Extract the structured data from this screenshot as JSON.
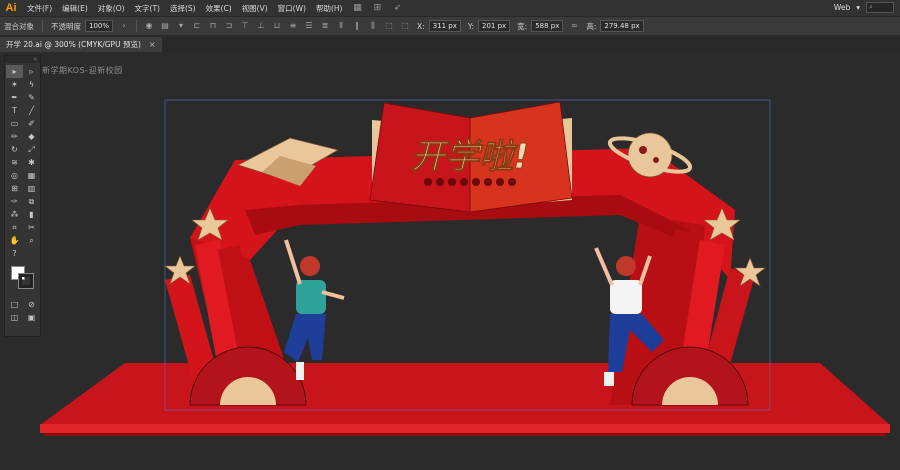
{
  "app": {
    "logo": "Ai"
  },
  "menu": {
    "items": [
      "文件(F)",
      "编辑(E)",
      "对象(O)",
      "文字(T)",
      "选择(S)",
      "效果(C)",
      "视图(V)",
      "窗口(W)",
      "帮助(H)"
    ],
    "workspace": "Web",
    "search_placeholder": ""
  },
  "control": {
    "group_label": "混合对象",
    "opacity_label": "不透明度",
    "opacity_value": "100%",
    "x_label": "X:",
    "x_value": "311 px",
    "y_label": "Y:",
    "y_value": "201 px",
    "w_label": "宽:",
    "w_value": "588 px",
    "h_label": "高:",
    "h_value": "279.48 px"
  },
  "document": {
    "tab_title": "开学 20.ai @ 300% (CMYK/GPU 预览)",
    "close": "×"
  },
  "artboard": {
    "title": "新学期KOS-迎新校园"
  },
  "artwork": {
    "banner_text": "开学啦!",
    "colors": {
      "red": "#d4141a",
      "dark_red": "#a80c10",
      "gold": "#e9c79a",
      "floor": "#c8141b",
      "teal": "#2fa39a",
      "blue": "#1f3e9a"
    }
  }
}
